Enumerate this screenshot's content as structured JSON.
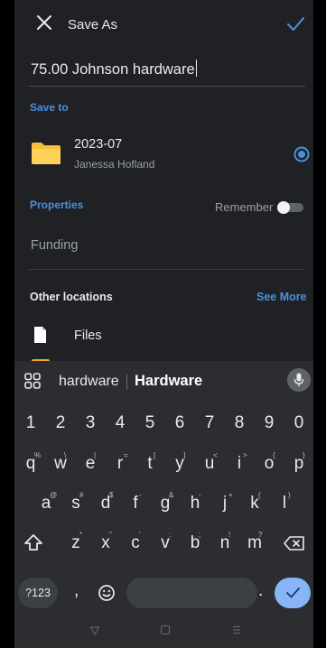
{
  "dialog": {
    "title": "Save As",
    "filename_value": "75.00 Johnson hardware"
  },
  "save_to": {
    "label": "Save to",
    "folder_name": "2023-07",
    "folder_owner": "Janessa Hofland"
  },
  "properties": {
    "label": "Properties",
    "remember_label": "Remember",
    "remember_enabled": false,
    "field_value": "Funding"
  },
  "other_locations": {
    "label": "Other locations",
    "see_more": "See More",
    "items": [
      "Files"
    ]
  },
  "keyboard": {
    "suggestions": [
      "hardware",
      "Hardware"
    ],
    "number_row": [
      "1",
      "2",
      "3",
      "4",
      "5",
      "6",
      "7",
      "8",
      "9",
      "0"
    ],
    "row1": [
      "q",
      "w",
      "e",
      "r",
      "t",
      "y",
      "u",
      "i",
      "o",
      "p"
    ],
    "row1_alt": [
      "%",
      "\\",
      "|",
      "=",
      "[",
      "]",
      "<",
      ">",
      "{",
      "}"
    ],
    "row2": [
      "a",
      "s",
      "d",
      "f",
      "g",
      "h",
      "j",
      "k",
      "l"
    ],
    "row2_alt": [
      "@",
      "#",
      "$",
      "-",
      "&",
      "-",
      "+",
      "(",
      ")"
    ],
    "row3": [
      "z",
      "x",
      "c",
      "v",
      "b",
      "n",
      "m"
    ],
    "row3_alt": [
      "*",
      "\"",
      "'",
      ":",
      ";",
      "!",
      "?"
    ],
    "symbols_key": "?123",
    "comma": ",",
    "period": "."
  },
  "colors": {
    "accent": "#4a90e2",
    "folder": "#f8c13a",
    "background": "#202124"
  }
}
